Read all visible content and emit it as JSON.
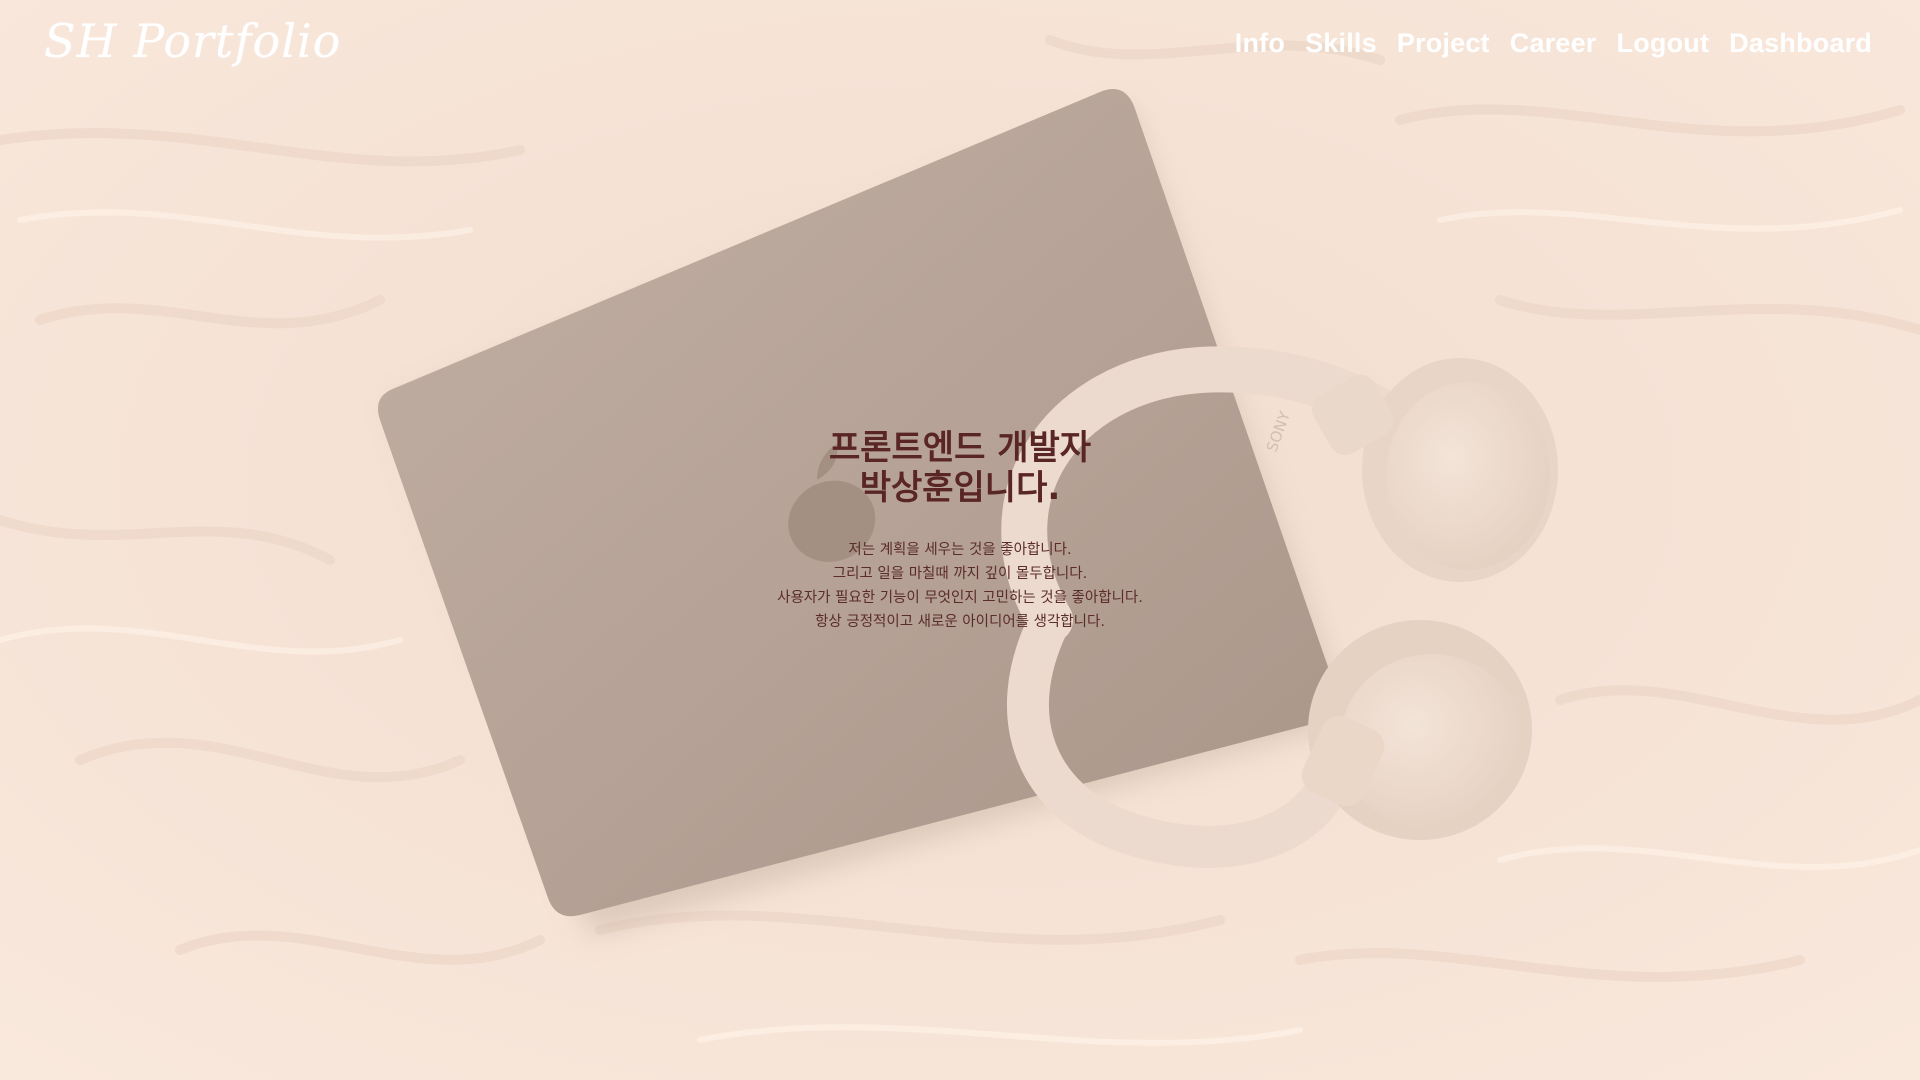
{
  "header": {
    "brand": "SH Portfolio",
    "nav": [
      "Info",
      "Skills",
      "Project",
      "Career",
      "Logout",
      "Dashboard"
    ]
  },
  "hero": {
    "title_lines": [
      "프론트엔드 개발자",
      "박상훈입니다."
    ],
    "description": [
      "저는 계획을 세우는 것을 좋아합니다.",
      "그리고 일을 마칠때 까지 깊이 몰두합니다.",
      "사용자가 필요한 기능이 무엇인지 고민하는 것을 좋아합니다.",
      "항상 긍정적이고 새로운 아이디어를 생각합니다."
    ],
    "headphone_brand": "SONY"
  },
  "colors": {
    "background": "#f6e3d5",
    "laptop": "#b9a69a",
    "headphones": "#f0dfd2",
    "nav_text": "#ffffff",
    "heading": "#5a2526"
  },
  "icons": {
    "laptop": "laptop-image",
    "apple_logo": "apple-logo-icon",
    "headphones": "headphones-image"
  }
}
